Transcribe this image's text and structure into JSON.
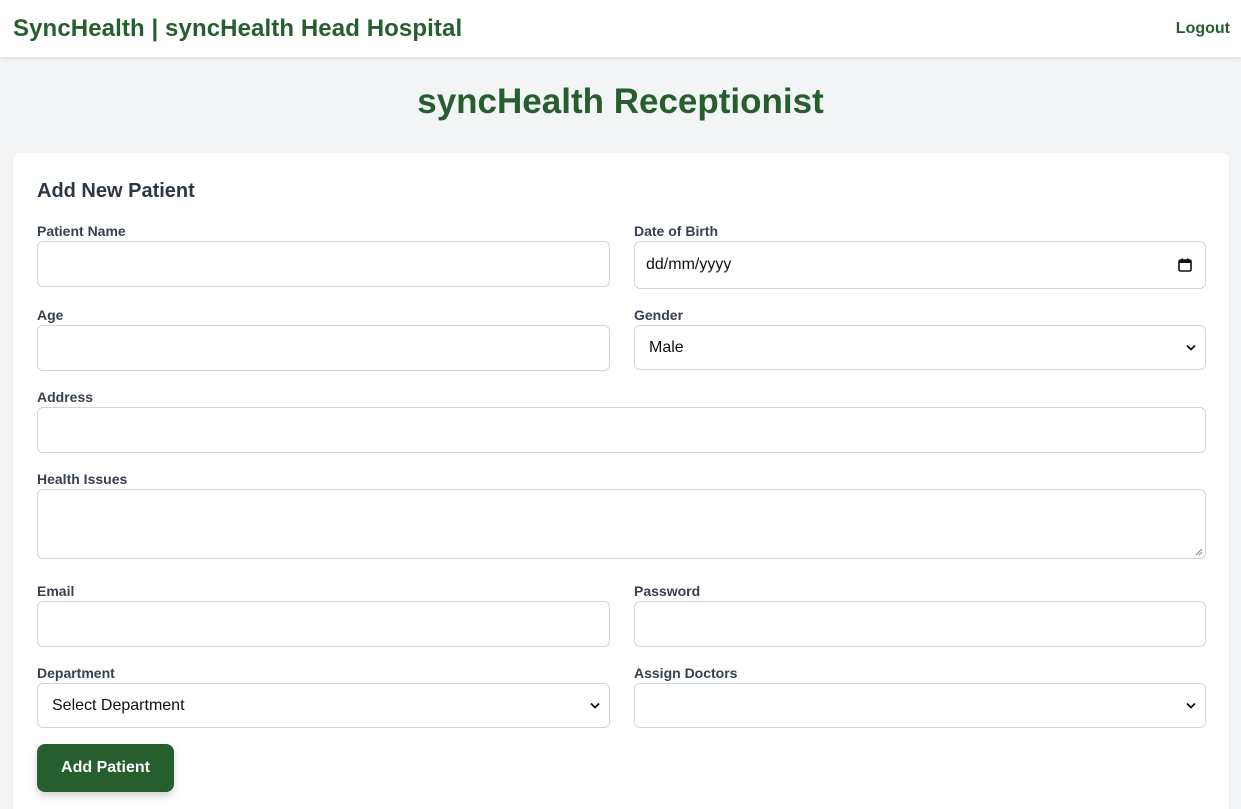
{
  "header": {
    "brand": "SyncHealth | syncHealth Head Hospital",
    "logout_label": "Logout"
  },
  "page": {
    "title": "syncHealth Receptionist"
  },
  "form": {
    "title": "Add New Patient",
    "patient_name": {
      "label": "Patient Name",
      "value": ""
    },
    "dob": {
      "label": "Date of Birth",
      "value": "dd/mm/yyyy"
    },
    "age": {
      "label": "Age",
      "value": ""
    },
    "gender": {
      "label": "Gender",
      "selected": "Male"
    },
    "address": {
      "label": "Address",
      "value": ""
    },
    "health_issues": {
      "label": "Health Issues",
      "value": ""
    },
    "email": {
      "label": "Email",
      "value": ""
    },
    "password": {
      "label": "Password",
      "value": ""
    },
    "department": {
      "label": "Department",
      "selected": "Select Department"
    },
    "doctors": {
      "label": "Assign Doctors",
      "selected": ""
    },
    "submit_label": "Add Patient"
  },
  "colors": {
    "brand_green": "#265e2d",
    "page_background": "#f3f4f6",
    "card_background": "#ffffff",
    "input_border": "#d1d5db"
  },
  "icons": {
    "date": "calendar-icon",
    "select": "chevron-down-icon",
    "textarea": "resize-handle-icon"
  }
}
